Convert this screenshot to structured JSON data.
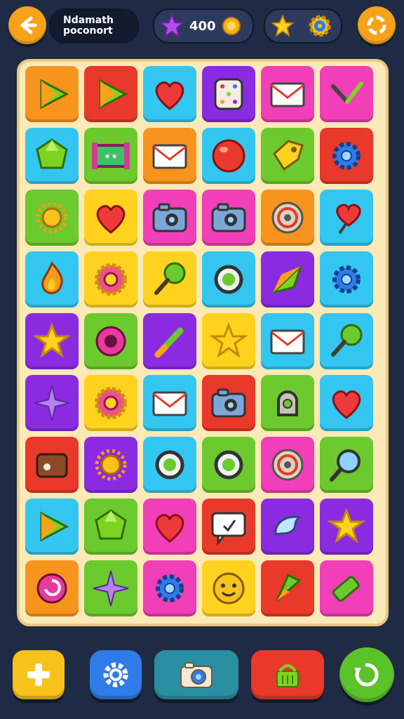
{
  "header": {
    "title": "Ndamath\npoconort",
    "score": "400"
  },
  "colors": {
    "orange": "#f7941d",
    "red": "#e8392b",
    "cyan": "#33c6f0",
    "purple": "#8a2be2",
    "magenta": "#f03fb8",
    "green": "#6cc92e",
    "yellow": "#ffd21f"
  },
  "board": {
    "rows": [
      [
        "orange:play-icon",
        "red:play-icon",
        "cyan:heart-icon",
        "purple:dice-icon",
        "magenta:mail-icon",
        "magenta:pen-icon"
      ],
      [
        "cyan:gem-icon",
        "green:film-icon",
        "orange:mail-icon",
        "cyan:ball-icon",
        "green:tag-icon",
        "red:gear-icon"
      ],
      [
        "green:sun-icon",
        "yellow:heart-icon",
        "magenta:camera-icon",
        "magenta:camera-icon",
        "orange:target-icon",
        "cyan:heart-pin-icon"
      ],
      [
        "cyan:flame-icon",
        "yellow:flower-icon",
        "yellow:pin-icon",
        "cyan:ring-icon",
        "purple:arrow-icon",
        "cyan:gear-icon"
      ],
      [
        "purple:star-icon",
        "green:donut-icon",
        "purple:pencil-icon",
        "yellow:star-icon",
        "cyan:mail-icon",
        "cyan:pin-icon"
      ],
      [
        "purple:sparkle-icon",
        "yellow:flower-icon",
        "cyan:mail-icon",
        "red:camera-icon",
        "green:lock-icon",
        "cyan:heart-icon"
      ],
      [
        "red:box-icon",
        "purple:sun-icon",
        "cyan:ring-icon",
        "green:ring-icon",
        "magenta:target-icon",
        "green:magnifier-icon"
      ],
      [
        "cyan:play-icon",
        "green:gem-icon",
        "magenta:heart-icon",
        "red:message-icon",
        "purple:snowflake-icon",
        "purple:star-icon"
      ],
      [
        "orange:swirl-icon",
        "green:sparkle-icon",
        "magenta:gear-icon",
        "yellow:face-icon",
        "red:cone-icon",
        "magenta:battery-icon"
      ]
    ]
  },
  "bottom": {
    "add": "add-icon",
    "settings": "gear-icon",
    "camera": "camera-icon",
    "shop": "basket-icon",
    "refresh": "refresh-icon"
  }
}
